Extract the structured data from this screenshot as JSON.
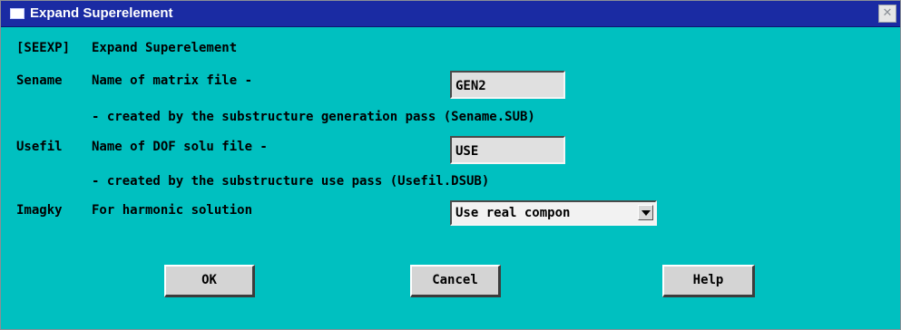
{
  "window": {
    "title": "Expand Superelement",
    "close_glyph": "✕"
  },
  "dialog": {
    "command_tag": "[SEEXP]",
    "command_desc": "Expand Superelement",
    "sename": {
      "label": "Sename",
      "desc": "Name of matrix file -",
      "value": "GEN2",
      "note": "- created by the substructure generation pass (Sename.SUB)"
    },
    "usefil": {
      "label": "Usefil",
      "desc": "Name of DOF solu file -",
      "value": "USE",
      "note": "- created by the substructure use pass (Usefil.DSUB)"
    },
    "imagky": {
      "label": "Imagky",
      "desc": "For harmonic solution",
      "selected": "Use real compon"
    }
  },
  "buttons": {
    "ok": "OK",
    "cancel": "Cancel",
    "help": "Help"
  },
  "colors": {
    "background": "#00c0c0",
    "titlebar": "#1a2ba3",
    "button_face": "#d4d4d4",
    "field_face": "#e0e0e0"
  },
  "icons": {
    "window": "window-icon",
    "close": "close-icon",
    "dropdown": "chevron-down-icon"
  }
}
